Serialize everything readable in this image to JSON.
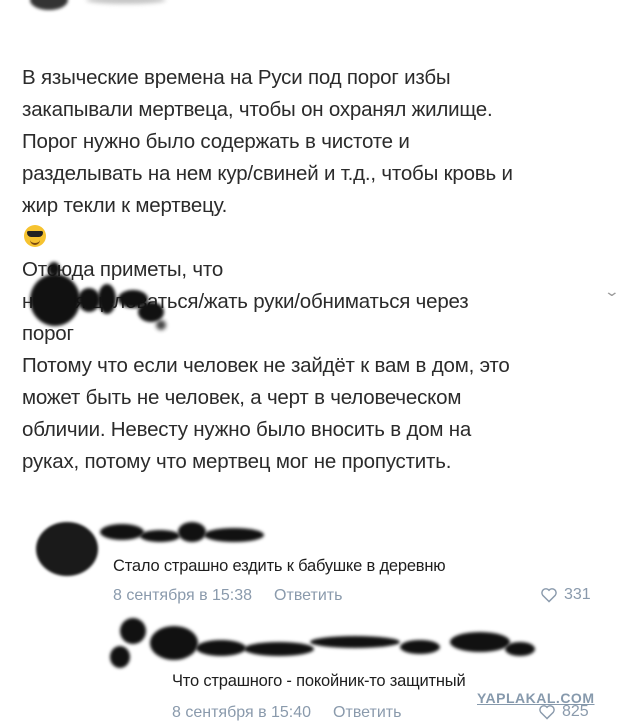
{
  "post": {
    "author_obscured": true,
    "text": "В языческие времена на Руси под порог избы\nзакапывали мертвеца, чтобы он охранял жилище.\nПорог нужно было содержать в чистоте и\nразделывать на нем кур/свиней и т.д., чтобы кровь и\nжир текли к мертвецу.",
    "emoji": "smiling-face-with-sunglasses",
    "text_after_emoji": " Отсюда приметы, что\nнельзя целоваться/жать руки/обниматься через\nпорог"
  },
  "reply_post": {
    "author_obscured": true,
    "text": "Потому что если человек не зайдёт к вам в дом, это\nможет быть не человек, а черт в человеческом\nобличии. Невесту нужно было вносить в дом на\nруках, потому что мертвец мог не пропустить."
  },
  "comments": [
    {
      "author_obscured": true,
      "text": "Стало страшно ездить к бабушке в деревню",
      "date": "8 сентября в 15:38",
      "reply_label": "Ответить",
      "likes": "331"
    },
    {
      "author_obscured": true,
      "text": "Что страшного - покойник-то защитный",
      "date": "8 сентября в 15:40",
      "reply_label": "Ответить",
      "likes": "825"
    }
  ],
  "watermark": "YAPLAKAL.COM",
  "colors": {
    "text": "#2b2b2b",
    "meta": "#8a9aac",
    "background": "#ffffff"
  }
}
